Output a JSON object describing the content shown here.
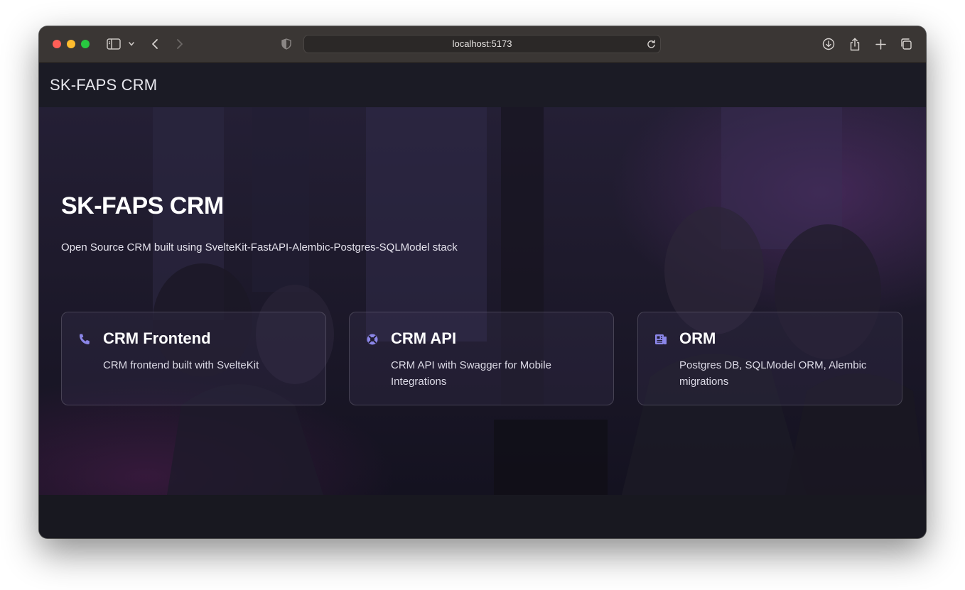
{
  "browser": {
    "url": "localhost:5173"
  },
  "header": {
    "brand": "SK-FAPS CRM"
  },
  "hero": {
    "title": "SK-FAPS CRM",
    "subtitle": "Open Source CRM built using SvelteKit-FastAPI-Alembic-Postgres-SQLModel stack"
  },
  "cards": [
    {
      "icon": "phone-icon",
      "title": "CRM Frontend",
      "description": "CRM frontend built with SvelteKit"
    },
    {
      "icon": "lifebuoy-icon",
      "title": "CRM API",
      "description": "CRM API with Swagger for Mobile Integrations"
    },
    {
      "icon": "newspaper-icon",
      "title": "ORM",
      "description": "Postgres DB, SQLModel ORM, Alembic migrations"
    }
  ],
  "colors": {
    "accent": "#8b86e8",
    "header_bg": "#1b1b25",
    "chrome_bg": "#3a3634"
  }
}
